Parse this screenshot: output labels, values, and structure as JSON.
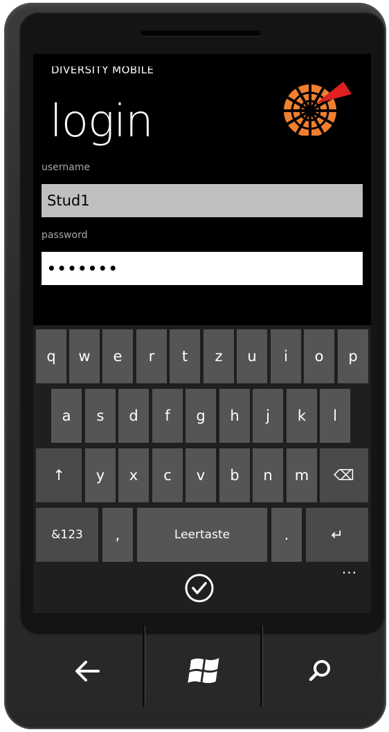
{
  "app": {
    "name": "DIVERSITY MOBILE",
    "page_title": "login"
  },
  "form": {
    "username_label": "username",
    "username_value": "Stud1",
    "password_label": "password",
    "password_value": "•••••••"
  },
  "keyboard": {
    "row1": [
      "q",
      "w",
      "e",
      "r",
      "t",
      "z",
      "u",
      "i",
      "o",
      "p"
    ],
    "row2": [
      "a",
      "s",
      "d",
      "f",
      "g",
      "h",
      "j",
      "k",
      "l"
    ],
    "row3": [
      "↑",
      "y",
      "x",
      "c",
      "v",
      "b",
      "n",
      "m",
      "⌫"
    ],
    "row4": {
      "symbols": "&123",
      "comma": ",",
      "space": "Leertaste",
      "period": ".",
      "enter": "↵"
    }
  },
  "app_bar": {
    "more": "···",
    "icon": "check-icon"
  },
  "hardware_buttons": [
    "back-icon",
    "windows-start-icon",
    "search-icon"
  ]
}
